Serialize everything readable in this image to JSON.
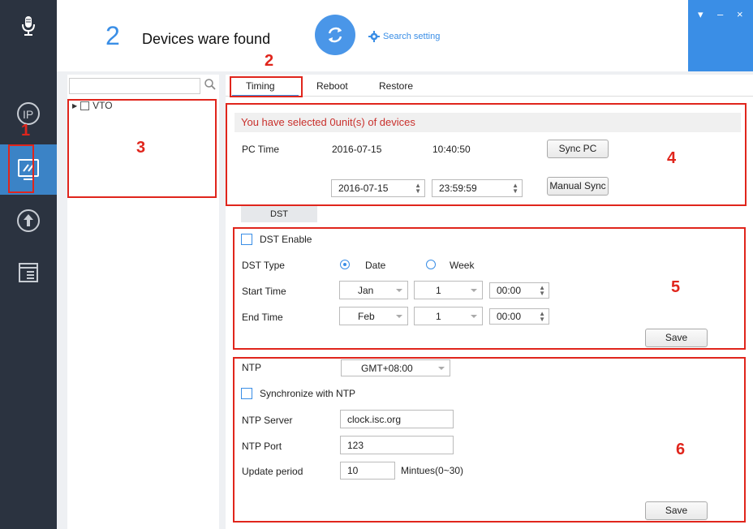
{
  "header": {
    "device_count": "2",
    "device_text": "Devices ware found",
    "search_setting": "Search setting",
    "controls": [
      "▾",
      "–",
      "×"
    ]
  },
  "sidebar": {
    "items": [
      {
        "icon": "microphone-icon"
      },
      {
        "icon": "ip-icon"
      },
      {
        "icon": "tools-icon",
        "active": true
      },
      {
        "icon": "upgrade-icon"
      },
      {
        "icon": "log-icon"
      }
    ]
  },
  "annotations": {
    "n1": "1",
    "n2": "2",
    "n3": "3",
    "n4": "4",
    "n5": "5",
    "n6": "6"
  },
  "tree": {
    "search_placeholder": "",
    "node_label": "VTO"
  },
  "tabs": [
    "Timing",
    "Reboot",
    "Restore"
  ],
  "timing": {
    "selected_msg": "You have selected 0unit(s) of devices",
    "pc_time_label": "PC Time",
    "pc_date": "2016-07-15",
    "pc_time": "10:40:50",
    "sync_pc": "Sync PC",
    "manual_date": "2016-07-15",
    "manual_time": "23:59:59",
    "manual_sync": "Manual Sync"
  },
  "dst": {
    "tab": "DST",
    "enable_label": "DST Enable",
    "type_label": "DST Type",
    "opt_date": "Date",
    "opt_week": "Week",
    "start_label": "Start Time",
    "start_month": "Jan",
    "start_day": "1",
    "start_time": "00:00",
    "end_label": "End Time",
    "end_month": "Feb",
    "end_day": "1",
    "end_time": "00:00",
    "save": "Save"
  },
  "ntp": {
    "label": "NTP",
    "timezone": "GMT+08:00",
    "sync_label": "Synchronize with NTP",
    "server_label": "NTP Server",
    "server_value": "clock.isc.org",
    "port_label": "NTP Port",
    "port_value": "123",
    "period_label": "Update period",
    "period_value": "10",
    "period_unit": "Mintues(0~30)",
    "save": "Save"
  },
  "colors": {
    "accent": "#3a8ee6",
    "sidebar": "#2b3340",
    "annotation": "#e0251c"
  }
}
